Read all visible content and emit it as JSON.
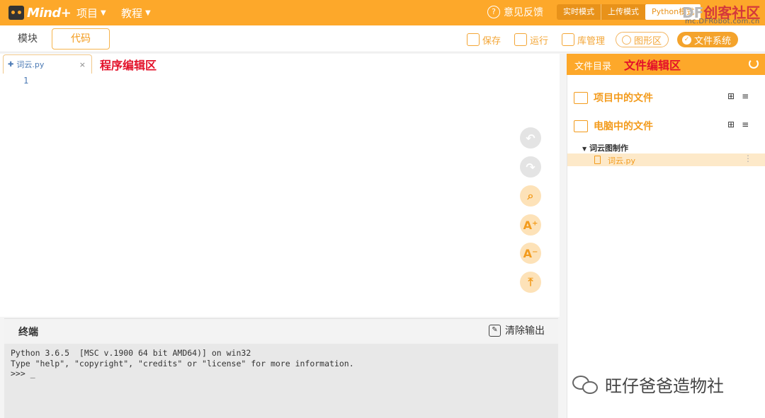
{
  "app": {
    "logo": "Mind+"
  },
  "menu": {
    "project": "项目",
    "tutorial": "教程"
  },
  "feedback": "意见反馈",
  "modes": [
    "实时模式",
    "上传模式",
    "Python模式"
  ],
  "watermark": {
    "brand_df": "DF",
    "brand": "创客社区",
    "url": "mc.DFRobot.com.cn"
  },
  "tabs": {
    "blocks": "模块",
    "code": "代码"
  },
  "toolbar": {
    "save": "保存",
    "run": "运行",
    "library": "库管理",
    "graphics": "图形区",
    "filesystem": "文件系统"
  },
  "editor": {
    "file_tab": "词云.py",
    "annotation": "程序编辑区",
    "line_numbers": [
      "1"
    ]
  },
  "terminal": {
    "title": "终端",
    "clear": "清除输出",
    "output": "Python 3.6.5  [MSC v.1900 64 bit AMD64)] on win32\nType \"help\", \"copyright\", \"credits\" or \"license\" for more information.\n>>> _"
  },
  "file_panel": {
    "title": "文件目录",
    "annotation": "文件编辑区",
    "project_files": "项目中的文件",
    "computer_files": "电脑中的文件",
    "folder": "词云图制作",
    "file": "词云.py"
  },
  "footer_watermark": "旺仔爸爸造物社"
}
